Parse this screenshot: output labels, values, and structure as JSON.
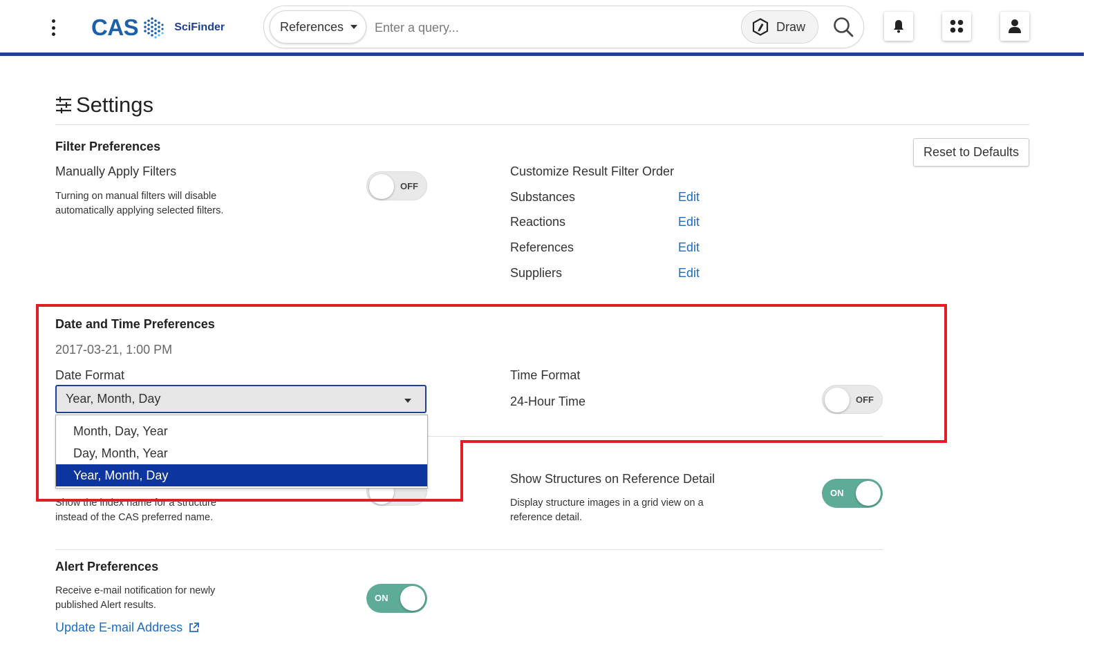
{
  "header": {
    "logo_cas": "CAS",
    "logo_product": "SciFinder",
    "search_type": "References",
    "search_placeholder": "Enter a query...",
    "draw_label": "Draw"
  },
  "page": {
    "title": "Settings",
    "reset_label": "Reset to Defaults"
  },
  "filter_preferences": {
    "heading": "Filter Preferences",
    "manual_label": "Manually Apply Filters",
    "manual_desc_line1": "Turning on manual filters will disable",
    "manual_desc_line2": "automatically applying selected filters.",
    "manual_toggle": "OFF",
    "order_heading": "Customize Result Filter Order",
    "items": [
      {
        "label": "Substances",
        "action": "Edit"
      },
      {
        "label": "Reactions",
        "action": "Edit"
      },
      {
        "label": "References",
        "action": "Edit"
      },
      {
        "label": "Suppliers",
        "action": "Edit"
      }
    ]
  },
  "date_time": {
    "heading": "Date and Time Preferences",
    "sample": "2017-03-21, 1:00 PM",
    "date_format_label": "Date Format",
    "date_format_value": "Year, Month, Day",
    "options": [
      "Month, Day, Year",
      "Day, Month, Year",
      "Year, Month, Day"
    ],
    "selected_option": 2,
    "time_format_label": "Time Format",
    "time_24_label": "24-Hour Time",
    "time_toggle": "OFF"
  },
  "structure": {
    "index_desc_line1": "Show the index name for a structure",
    "index_desc_line2": "instead of the CAS preferred name.",
    "show_structures_label": "Show Structures on Reference Detail",
    "show_structures_desc_line1": "Display structure images in a grid view on a",
    "show_structures_desc_line2": "reference detail.",
    "show_structures_toggle": "ON"
  },
  "alerts": {
    "heading": "Alert Preferences",
    "desc_line1": "Receive e-mail notification for newly",
    "desc_line2": "published Alert results.",
    "toggle": "ON",
    "update_email": "Update E-mail Address"
  },
  "colors": {
    "brand_blue": "#1d3f94",
    "link_blue": "#1e6bc0",
    "toggle_on": "#5eac98",
    "highlight_red": "#e01e26",
    "menu_selected": "#0d35a0"
  }
}
